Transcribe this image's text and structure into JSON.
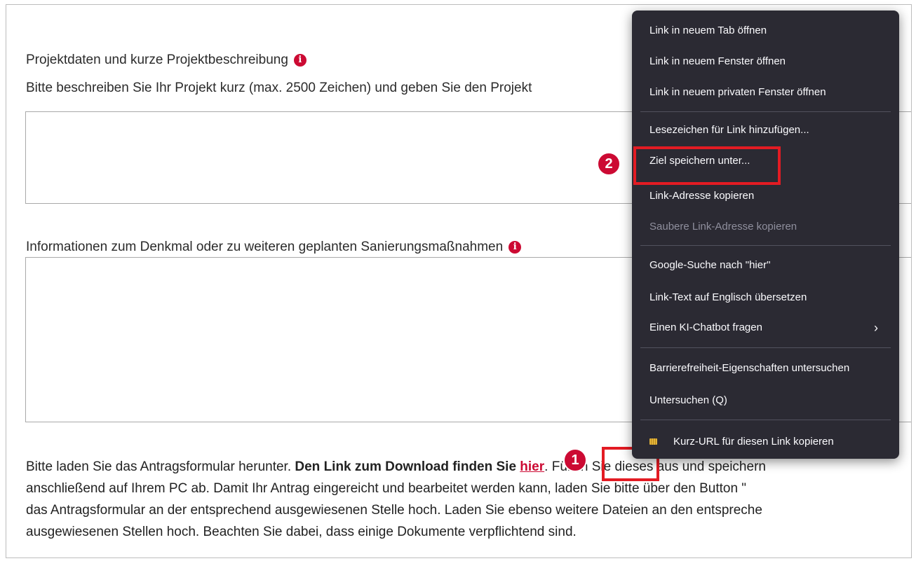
{
  "form": {
    "section1_label": "Projektdaten und kurze Projektbeschreibung",
    "section1_help": "Bitte beschreiben Sie Ihr Projekt kurz (max. 2500 Zeichen) und geben Sie den Projekt",
    "section2_label": "Informationen zum Denkmal oder zu weiteren geplanten Sanierungsmaßnahmen",
    "info_icon_glyph": "i"
  },
  "instructions": {
    "line1_part1": "Bitte laden Sie das Antragsformular herunter. ",
    "line1_bold": "Den Link zum Download finden Sie ",
    "line1_link": "hier",
    "line1_part2": ". Füllen Sie dieses aus und speichern",
    "line2": "anschließend auf Ihrem PC ab. Damit Ihr Antrag eingereicht und bearbeitet werden kann, laden Sie bitte über den Button \"",
    "line3": "das Antragsformular an der entsprechend ausgewiesenen Stelle hoch. Laden Sie ebenso weitere Dateien an den entspreche",
    "line4": "ausgewiesenen Stellen hoch. Beachten Sie dabei, dass einige Dokumente verpflichtend sind."
  },
  "context_menu": {
    "items": [
      {
        "label": "Link in neuem Tab öffnen"
      },
      {
        "label": "Link in neuem Fenster öffnen"
      },
      {
        "label": "Link in neuem privaten Fenster öffnen"
      },
      {
        "label": "Lesezeichen für Link hinzufügen..."
      },
      {
        "label": "Ziel speichern unter..."
      },
      {
        "label": "Link-Adresse kopieren"
      },
      {
        "label": "Saubere Link-Adresse kopieren"
      },
      {
        "label": "Google-Suche nach \"hier\""
      },
      {
        "label": "Link-Text auf Englisch übersetzen"
      },
      {
        "label": "Einen KI-Chatbot fragen"
      },
      {
        "label": "Barrierefreiheit-Eigenschaften untersuchen"
      },
      {
        "label": "Untersuchen (Q)"
      },
      {
        "label": "Kurz-URL für diesen Link kopieren"
      }
    ],
    "submenu_chevron": "›"
  },
  "annotations": {
    "step1": "1",
    "step2": "2"
  },
  "colors": {
    "accent_red": "#cc0a33",
    "highlight_red": "#e31b23",
    "menu_bg": "#2b2a33",
    "menu_text": "#fbfbfe",
    "menu_disabled": "#8f8f9d"
  }
}
